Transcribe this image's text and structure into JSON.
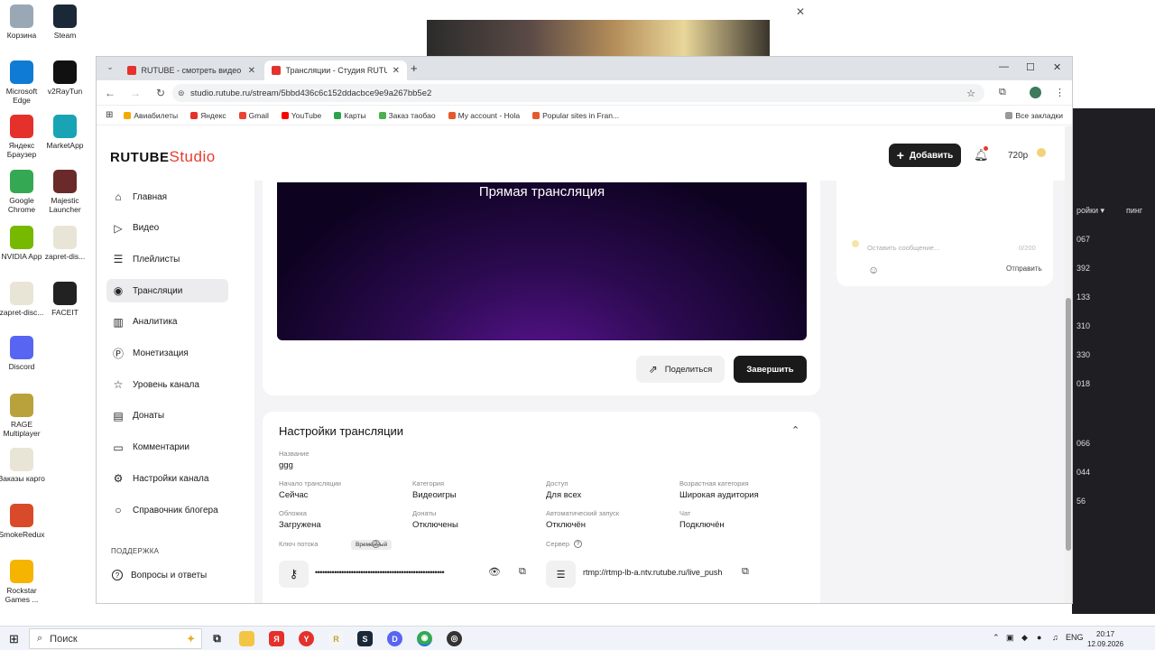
{
  "desktop": {
    "icons": [
      {
        "label": "Корзина",
        "color": "#9aa7b5"
      },
      {
        "label": "Steam",
        "color": "#1b2838"
      },
      {
        "label": "Microsoft Edge",
        "color": "#0f7bd4"
      },
      {
        "label": "v2RayTun",
        "color": "#111111"
      },
      {
        "label": "Яндекс Браузер",
        "color": "#e4312b"
      },
      {
        "label": "MarketApp",
        "color": "#18a4b4"
      },
      {
        "label": "Google Chrome",
        "color": "#34a853"
      },
      {
        "label": "Majestic Launcher",
        "color": "#6b2a2a"
      },
      {
        "label": "NVIDIA App",
        "color": "#76b900"
      },
      {
        "label": "zapret-dis...",
        "color": "#e9e5d6"
      },
      {
        "label": "zapret-disc...",
        "color": "#e9e5d6"
      },
      {
        "label": "FACEIT",
        "color": "#222222"
      },
      {
        "label": "Discord",
        "color": "#5865f2"
      },
      {
        "label": "RAGE Multiplayer",
        "color": "#b9a23b"
      },
      {
        "label": "Заказы карго",
        "color": "#e9e5d6"
      },
      {
        "label": "SmokeRedux",
        "color": "#d94a2a"
      },
      {
        "label": "Rockstar Games ...",
        "color": "#f5b400"
      }
    ],
    "right_panel": {
      "labels": [
        "ройки ▾",
        "пинг",
        "067",
        "392",
        "133",
        "310",
        "330",
        "018",
        "066",
        "044",
        "56"
      ]
    }
  },
  "browser": {
    "tabs": [
      {
        "title": "RUTUBE - смотреть видео он..."
      },
      {
        "title": "Трансляции - Студия RUTUBE"
      }
    ],
    "new_tab": "+",
    "url": "studio.rutube.ru/stream/5bbd436c6c152ddacbce9e9a267bb5e2",
    "bookmarks": [
      {
        "label": "Авиабилеты",
        "color": "#f2a900"
      },
      {
        "label": "Яндекс",
        "color": "#e4312b"
      },
      {
        "label": "Gmail",
        "color": "#ea4335"
      },
      {
        "label": "YouTube",
        "color": "#ff0000"
      },
      {
        "label": "Карты",
        "color": "#2aa34a"
      },
      {
        "label": "Заказ таобао",
        "color": "#4caf50"
      },
      {
        "label": "My account - Hola",
        "color": "#e55a2b"
      },
      {
        "label": "Popular sites in Fran...",
        "color": "#e55a2b"
      }
    ],
    "all_bookmarks": "Все закладки"
  },
  "header": {
    "logo_brand": "RUTUBE",
    "logo_studio": "Studio",
    "add_button": "Добавить",
    "quality": "720p"
  },
  "sidebar": {
    "items": [
      {
        "label": "Главная",
        "icon": "home-icon",
        "glyph": "⌂"
      },
      {
        "label": "Видео",
        "icon": "video-icon",
        "glyph": "▷"
      },
      {
        "label": "Плейлисты",
        "icon": "playlist-icon",
        "glyph": "☰"
      },
      {
        "label": "Трансляции",
        "icon": "broadcast-icon",
        "glyph": "◉"
      },
      {
        "label": "Аналитика",
        "icon": "analytics-icon",
        "glyph": "▥"
      },
      {
        "label": "Монетизация",
        "icon": "monetization-icon",
        "glyph": "Ⓟ"
      },
      {
        "label": "Уровень канала",
        "icon": "star-icon",
        "glyph": "☆"
      },
      {
        "label": "Донаты",
        "icon": "donate-icon",
        "glyph": "▤"
      },
      {
        "label": "Комментарии",
        "icon": "comments-icon",
        "glyph": "▭"
      },
      {
        "label": "Настройки канала",
        "icon": "gear-icon",
        "glyph": "⚙"
      },
      {
        "label": "Справочник блогера",
        "icon": "guide-icon",
        "glyph": "○"
      }
    ],
    "support_section": "ПОДДЕРЖКА",
    "faq": {
      "label": "Вопросы и ответы",
      "icon": "help-icon",
      "glyph": "?"
    }
  },
  "player": {
    "title": "Прямая трансляция"
  },
  "actions": {
    "share": "Поделиться",
    "finish": "Завершить"
  },
  "settings": {
    "title": "Настройки трансляции",
    "name_label": "Название",
    "name_value": "ggg",
    "fields": [
      {
        "label": "Начало трансляции",
        "value": "Сейчас"
      },
      {
        "label": "Категория",
        "value": "Видеоигры"
      },
      {
        "label": "Доступ",
        "value": "Для всех"
      },
      {
        "label": "Возрастная категория",
        "value": "Широкая аудитория"
      },
      {
        "label": "Обложка",
        "value": "Загружена"
      },
      {
        "label": "Донаты",
        "value": "Отключены"
      },
      {
        "label": "Автоматический запуск",
        "value": "Отключён"
      },
      {
        "label": "Чат",
        "value": "Подключён"
      }
    ],
    "stream_key_label": "Ключ потока",
    "stream_key_badge": "Временный",
    "stream_key_value": "••••••••••••••••••••••••••••••••••••••••••••••••••••••",
    "server_label": "Сервер",
    "server_value": "rtmp://rtmp-lb-a.ntv.rutube.ru/live_push"
  },
  "chat": {
    "placeholder": "Оставить сообщение...",
    "counter": "0/200",
    "send": "Отправить"
  },
  "taskbar": {
    "search": "Поиск",
    "lang": "ENG",
    "time": "20:17",
    "date": "12.09.2026"
  }
}
